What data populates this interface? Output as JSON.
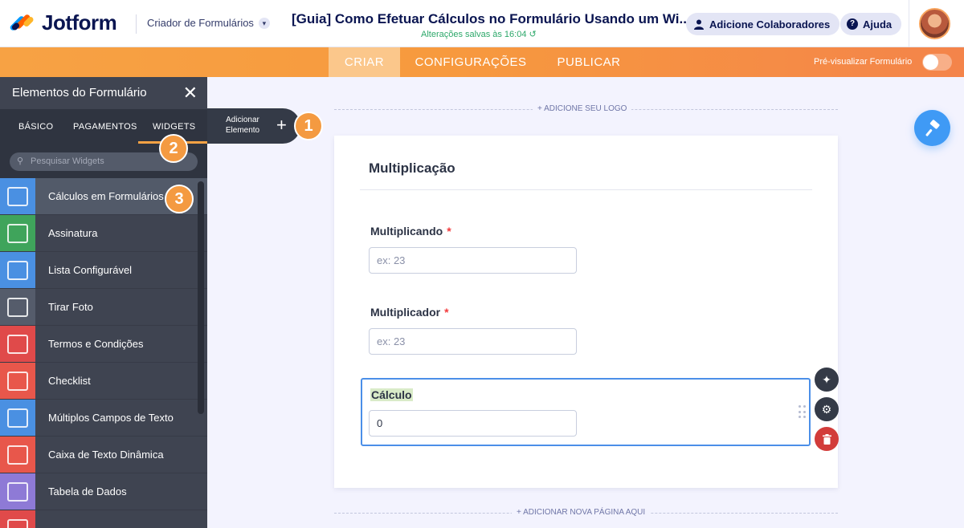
{
  "header": {
    "logo_text": "Jotform",
    "builder_label": "Criador de Formulários",
    "form_title": "[Guia] Como Efetuar Cálculos no Formulário Usando um Wi...",
    "saved_status": "Alterações salvas às 16:04",
    "collaborators_label": "Adicione Colaboradores",
    "help_label": "Ajuda"
  },
  "nav": {
    "tabs": [
      {
        "label": "CRIAR"
      },
      {
        "label": "CONFIGURAÇÕES"
      },
      {
        "label": "PUBLICAR"
      }
    ],
    "preview_label": "Pré-visualizar Formulário",
    "preview_enabled": false
  },
  "sidebar": {
    "title": "Elementos do Formulário",
    "tabs": [
      {
        "label": "BÁSICO"
      },
      {
        "label": "PAGAMENTOS"
      },
      {
        "label": "WIDGETS"
      }
    ],
    "search_placeholder": "Pesquisar Widgets",
    "items": [
      {
        "label": "Cálculos em Formulários",
        "icon": "calculator-icon",
        "color": "#4a90e2"
      },
      {
        "label": "Assinatura",
        "icon": "signature-icon",
        "color": "#3fa45b"
      },
      {
        "label": "Lista Configurável",
        "icon": "configurable-list-icon",
        "color": "#4a90e2"
      },
      {
        "label": "Tirar Foto",
        "icon": "camera-icon",
        "color": "#555c6b"
      },
      {
        "label": "Termos e Condições",
        "icon": "terms-document-icon",
        "color": "#e04a4a"
      },
      {
        "label": "Checklist",
        "icon": "checklist-icon",
        "color": "#e8574b"
      },
      {
        "label": "Múltiplos Campos de Texto",
        "icon": "multiple-text-fields-icon",
        "color": "#4a90e2"
      },
      {
        "label": "Caixa de Texto Dinâmica",
        "icon": "dynamic-textbox-icon",
        "color": "#e8574b"
      },
      {
        "label": "Tabela de Dados",
        "icon": "data-table-icon",
        "color": "#8e7ad6"
      },
      {
        "label": "",
        "icon": "widget-icon",
        "color": "#e04a4a"
      }
    ]
  },
  "add_element": {
    "line1": "Adicionar",
    "line2": "Elemento"
  },
  "badges": [
    "1",
    "2",
    "3"
  ],
  "canvas": {
    "logo_hint": "+ ADICIONE SEU LOGO",
    "new_page_hint": "+ ADICIONAR NOVA PÁGINA AQUI"
  },
  "form": {
    "heading": "Multiplicação",
    "fields": [
      {
        "label": "Multiplicando",
        "required": "*",
        "placeholder": "ex: 23"
      },
      {
        "label": "Multiplicador",
        "required": "*",
        "placeholder": "ex: 23"
      }
    ],
    "calc": {
      "label": "Cálculo",
      "value": "0"
    }
  },
  "colors": {
    "accent_orange": "#f7a244",
    "accent_blue": "#3f9af5",
    "delete_red": "#d23c3a",
    "sidebar_bg": "#3f4451"
  }
}
